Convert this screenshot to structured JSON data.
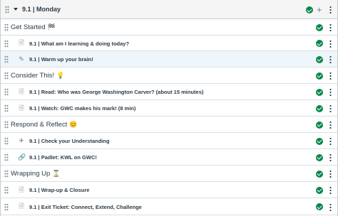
{
  "module": {
    "title": "9.1 | Monday",
    "complete_icon": "check-circle-icon",
    "add_icon": "plus-icon",
    "menu_icon": "kebab-menu-icon"
  },
  "rows": [
    {
      "kind": "header",
      "label": "Get Started",
      "emoji": "🏁"
    },
    {
      "kind": "item",
      "icon": "page-icon",
      "label": "9.1 | What am I learning & doing today?"
    },
    {
      "kind": "item",
      "icon": "assignment-icon",
      "label": "9.1 | Warm up your brain!",
      "highlight": true
    },
    {
      "kind": "header",
      "label": "Consider This!",
      "emoji": "💡"
    },
    {
      "kind": "item",
      "icon": "page-icon",
      "label": "9.1 | Read: Who was George Washington Carver? (about 15 minutes)"
    },
    {
      "kind": "item",
      "icon": "page-icon",
      "label": "9.1 | Watch: GWC makes his mark! (8 min)"
    },
    {
      "kind": "header",
      "label": "Respond & Reflect",
      "emoji": "😊"
    },
    {
      "kind": "item",
      "icon": "quiz-icon",
      "label": "9.1 | Check your Understanding"
    },
    {
      "kind": "item",
      "icon": "link-icon",
      "label": "9.1 | Padlet: KWL on GWC!"
    },
    {
      "kind": "header",
      "label": "Wrapping Up",
      "emoji": "⌛"
    },
    {
      "kind": "item",
      "icon": "page-icon",
      "label": "9.1 | Wrap-up & Closure"
    },
    {
      "kind": "item",
      "icon": "page-icon",
      "label": "9.1 | Exit Ticket: Connect, Extend, Challenge"
    }
  ],
  "colors": {
    "complete": "#0b874b",
    "highlight_row": "#eef6fb",
    "header_bg": "#f5f5f5"
  }
}
